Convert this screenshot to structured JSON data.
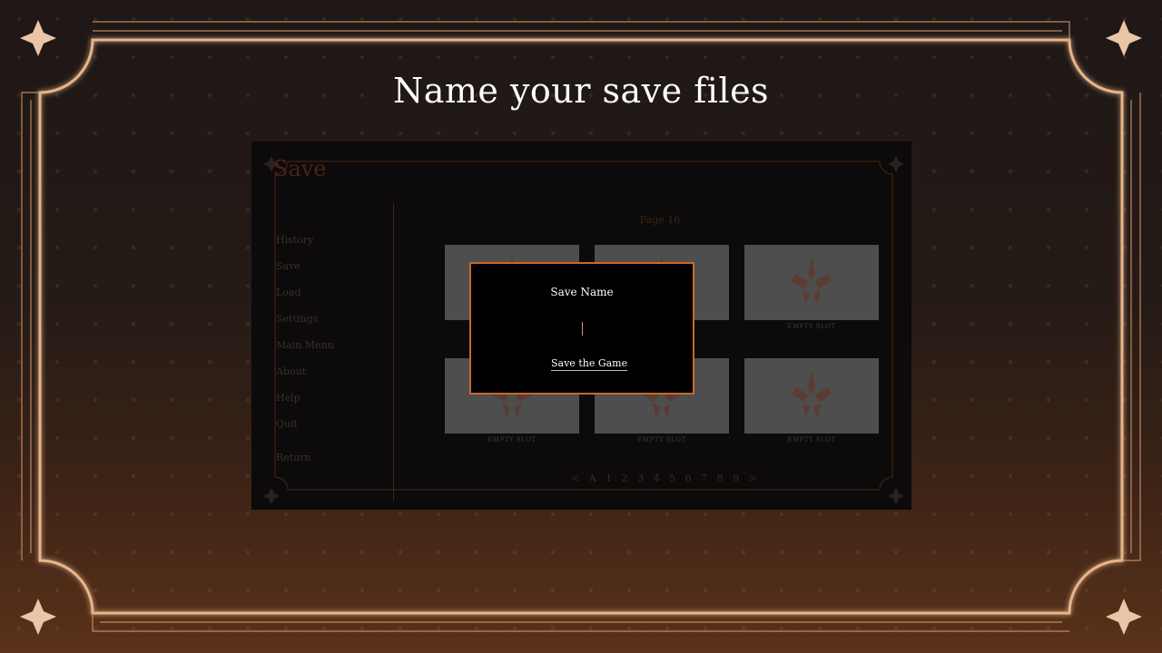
{
  "heading": "Name your save files",
  "game_screen": {
    "screen_title": "Save",
    "nav_items": [
      "History",
      "Save",
      "Load",
      "Settings",
      "Main Menu",
      "About",
      "Help",
      "Quit"
    ],
    "return_label": "Return",
    "page_label": "Page 16",
    "slots": [
      {
        "label": ""
      },
      {
        "label": ""
      },
      {
        "label": "EMPTY SLOT"
      },
      {
        "label": "EMPTY SLOT"
      },
      {
        "label": "EMPTY SLOT"
      },
      {
        "label": "EMPTY SLOT"
      }
    ],
    "pager": {
      "prev": "<",
      "pages": [
        "A",
        "1",
        "2",
        "3",
        "4",
        "5",
        "6",
        "7",
        "8",
        "9"
      ],
      "next": ">"
    }
  },
  "dialog": {
    "title": "Save Name",
    "input_value": "",
    "save_button": "Save the Game"
  },
  "colors": {
    "accent": "#c8692a",
    "frame": "#e8b48a",
    "title_text": "#ffffff"
  }
}
